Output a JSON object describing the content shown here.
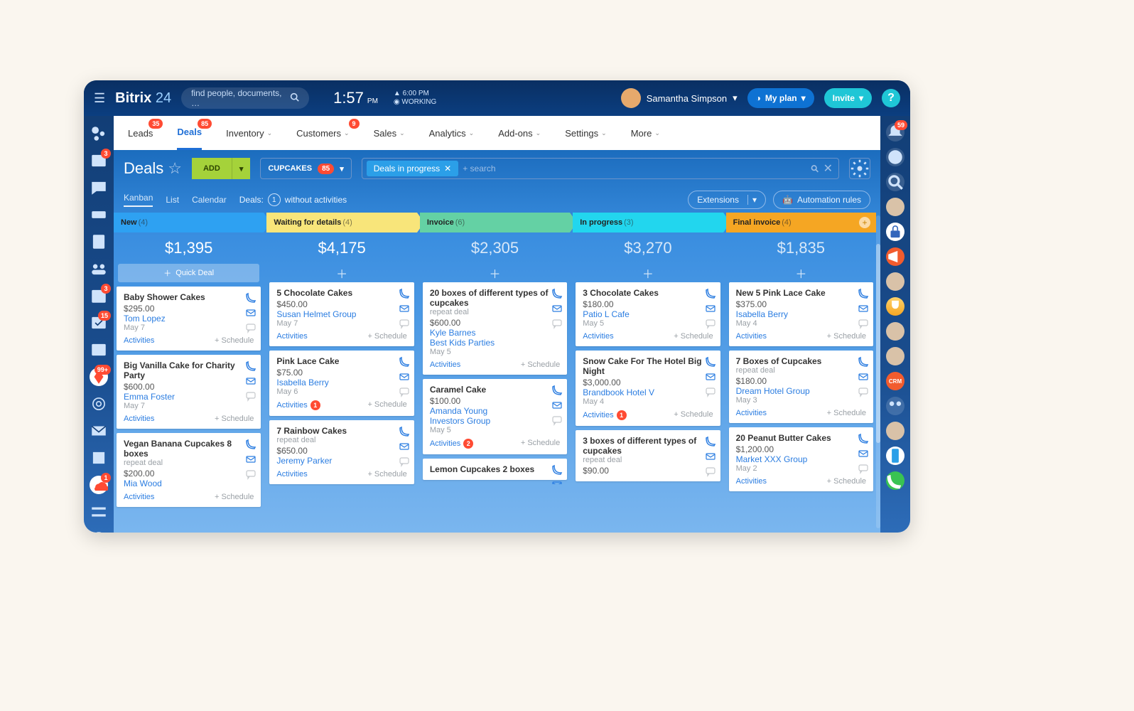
{
  "topbar": {
    "brand_a": "Bitrix",
    "brand_b": "24",
    "search_placeholder": "find people, documents, …",
    "clock_time": "1:57",
    "clock_ampm": "PM",
    "clock_meta_time": "6:00 PM",
    "clock_status": "WORKING",
    "user_name": "Samantha Simpson",
    "my_plan": "My plan",
    "invite": "Invite"
  },
  "tabs": [
    {
      "label": "Leads",
      "badge": "35"
    },
    {
      "label": "Deals",
      "badge": "85"
    },
    {
      "label": "Inventory",
      "badge": ""
    },
    {
      "label": "Customers",
      "badge": "9"
    },
    {
      "label": "Sales",
      "badge": ""
    },
    {
      "label": "Analytics",
      "badge": ""
    },
    {
      "label": "Add-ons",
      "badge": ""
    },
    {
      "label": "Settings",
      "badge": ""
    },
    {
      "label": "More",
      "badge": ""
    }
  ],
  "controls": {
    "page_title": "Deals",
    "add": "ADD",
    "chip_label": "CUPCAKES",
    "chip_count": "85",
    "filter_tag": "Deals in progress",
    "filter_placeholder": "+ search"
  },
  "subrow": {
    "views": [
      "Kanban",
      "List",
      "Calendar"
    ],
    "deals_label": "Deals:",
    "deals_count": "1",
    "deals_suffix": "without activities",
    "extensions": "Extensions",
    "automation": "Automation rules"
  },
  "rbar_badges": {
    "bell": "59"
  },
  "lbar_badges": [
    "3",
    "",
    "",
    "",
    "3",
    "15",
    "",
    "99+",
    "",
    "",
    "",
    "1",
    "",
    "",
    "",
    "",
    "",
    ""
  ],
  "columns": [
    {
      "name": "New",
      "count": "(4)",
      "color": "#2ea1f2",
      "total": "$1,395",
      "quick": "Quick Deal",
      "cards": [
        {
          "title": "Baby Shower Cakes",
          "price": "$295.00",
          "links": [
            "Tom Lopez"
          ],
          "date": "May 7"
        },
        {
          "title": "Big Vanilla Cake for Charity Party",
          "price": "$600.00",
          "links": [
            "Emma Foster"
          ],
          "date": "May 7"
        },
        {
          "title": "Vegan Banana Cupcakes 8 boxes",
          "sub": "repeat deal",
          "price": "$200.00",
          "links": [
            "Mia Wood"
          ],
          "date": ""
        }
      ]
    },
    {
      "name": "Waiting for details",
      "count": "(4)",
      "color": "#f8e57a",
      "total": "$4,175",
      "cards": [
        {
          "title": "5 Chocolate Cakes",
          "price": "$450.00",
          "links": [
            "Susan Helmet Group"
          ],
          "date": "May 7"
        },
        {
          "title": "Pink Lace Cake",
          "price": "$75.00",
          "links": [
            "Isabella Berry"
          ],
          "date": "May 6",
          "actbadge": "1"
        },
        {
          "title": "7 Rainbow Cakes",
          "sub": "repeat deal",
          "price": "$650.00",
          "links": [
            "Jeremy Parker"
          ],
          "date": ""
        }
      ]
    },
    {
      "name": "Invoice",
      "count": "(6)",
      "color": "#64d1a4",
      "total": "$2,305",
      "cards": [
        {
          "title": "20 boxes of different types of cupcakes",
          "sub": "repeat deal",
          "price": "$600.00",
          "links": [
            "Kyle Barnes",
            "Best Kids Parties"
          ],
          "date": "May 5"
        },
        {
          "title": "Caramel Cake",
          "price": "$100.00",
          "links": [
            "Amanda Young",
            "Investors Group"
          ],
          "date": "May 5",
          "actbadge": "2"
        },
        {
          "title": "Lemon Cupcakes 2 boxes",
          "price": "",
          "links": [],
          "date": ""
        }
      ]
    },
    {
      "name": "In progress",
      "count": "(3)",
      "color": "#22d6ee",
      "total": "$3,270",
      "cards": [
        {
          "title": "3 Chocolate Cakes",
          "price": "$180.00",
          "links": [
            "Patio L Cafe"
          ],
          "date": "May 5"
        },
        {
          "title": "Snow Cake For The Hotel Big Night",
          "price": "$3,000.00",
          "links": [
            "Brandbook Hotel V"
          ],
          "date": "May 4",
          "actbadge": "1"
        },
        {
          "title": "3 boxes of different types of cupcakes",
          "sub": "repeat deal",
          "price": "$90.00",
          "links": [],
          "date": ""
        }
      ]
    },
    {
      "name": "Final invoice",
      "count": "(4)",
      "color": "#f5a623",
      "total": "$1,835",
      "cards": [
        {
          "title": "New 5 Pink Lace Cake",
          "price": "$375.00",
          "links": [
            "Isabella Berry"
          ],
          "date": "May 4"
        },
        {
          "title": "7 Boxes of Cupcakes",
          "sub": "repeat deal",
          "price": "$180.00",
          "links": [
            "Dream Hotel Group"
          ],
          "date": "May 3"
        },
        {
          "title": "20 Peanut Butter Cakes",
          "price": "$1,200.00",
          "links": [
            "Market XXX Group"
          ],
          "date": "May 2"
        }
      ]
    }
  ],
  "strings": {
    "activities": "Activities",
    "schedule": "+ Schedule"
  }
}
